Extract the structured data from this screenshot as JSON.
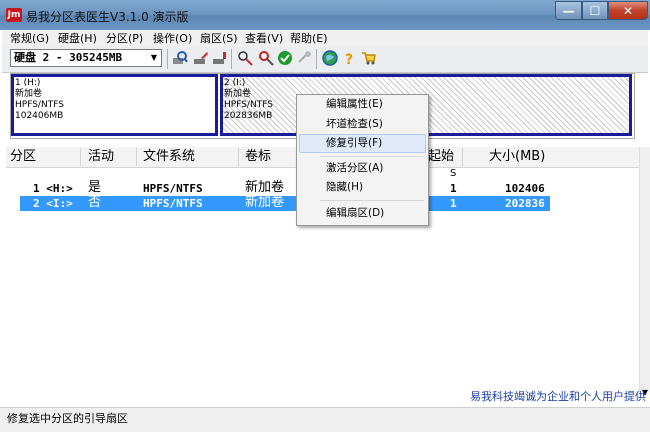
{
  "window": {
    "title": "易我分区表医生V3.1.0 演示版",
    "app_icon": "Jm",
    "minimize": "—",
    "maximize": "☐",
    "close": "✕"
  },
  "menu": [
    {
      "label": "常规(G)"
    },
    {
      "label": "硬盘(H)"
    },
    {
      "label": "分区(P)"
    },
    {
      "label": "操作(O)"
    },
    {
      "label": "扇区(S)"
    },
    {
      "label": "查看(V)"
    },
    {
      "label": "帮助(E)"
    }
  ],
  "toolbar": {
    "disk_select_value": "硬盘 2 - 305245MB",
    "icons": [
      "search-drive-icon",
      "backup-drive-icon",
      "restore-drive-icon",
      "partition-tool-icon",
      "magnifier-icon",
      "check-icon",
      "refresh-icon",
      "globe-icon",
      "help-icon",
      "cart-icon"
    ]
  },
  "disk_map": {
    "partitions": [
      {
        "id": "1 (H:)",
        "name": "新加卷",
        "fs": "HPFS/NTFS",
        "size": "102406MB"
      },
      {
        "id": "2 (I:)",
        "name": "新加卷",
        "fs": "HPFS/NTFS",
        "size": "202836MB"
      }
    ]
  },
  "list": {
    "columns": [
      "分区",
      "活动",
      "文件系统",
      "卷标",
      "起始",
      "大小(MB)"
    ],
    "sub_marker": "S",
    "rows": [
      {
        "partition": "1 <H:>",
        "active": "是",
        "fs": "HPFS/NTFS",
        "label": "新加卷",
        "start": "1",
        "size": "102406"
      },
      {
        "partition": "2 <I:>",
        "active": "否",
        "fs": "HPFS/NTFS",
        "label": "新加卷",
        "start": "1",
        "size": "202836"
      }
    ],
    "selected_row": 1
  },
  "context_menu": {
    "items": [
      "编辑属性(E)",
      "坏道检查(S)",
      "修复引导(F)",
      "激活分区(A)",
      "隐藏(H)",
      "编辑扇区(D)"
    ],
    "highlighted": "修复引导(F)"
  },
  "ad_text": "易我科技竭诚为企业和个人用户提供",
  "status": {
    "text": "修复选中分区的引导扇区"
  },
  "colors": {
    "titlebar": "#6d97c2",
    "partition_border": "#1a1a9c",
    "selection": "#3399ff",
    "close_button": "#c2422a",
    "ad_text": "#1a3ea8"
  }
}
